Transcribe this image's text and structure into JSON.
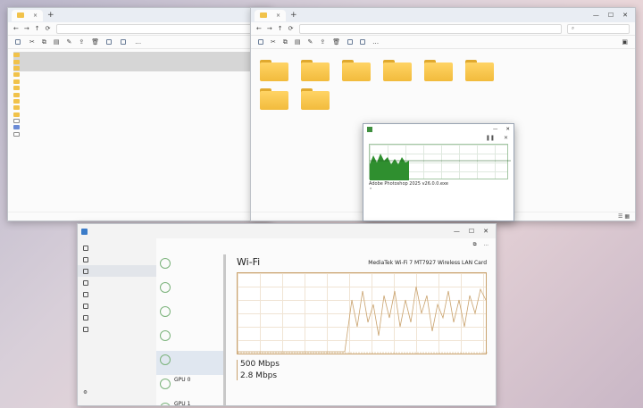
{
  "left_explorer": {
    "tab_title": "",
    "address": "",
    "search_placeholder": "",
    "commands": [
      {
        "label": "",
        "icon": "new-icon"
      },
      {
        "label": "",
        "icon": "sort-icon"
      },
      {
        "label": "",
        "icon": "view-icon"
      }
    ],
    "files": [
      {
        "name": "",
        "date": "",
        "type": "",
        "size": "",
        "kind": "folder",
        "selected": true
      },
      {
        "name": "",
        "date": "",
        "type": "",
        "size": "",
        "kind": "folder",
        "selected": true
      },
      {
        "name": "",
        "date": "",
        "type": "",
        "size": "",
        "kind": "folder",
        "selected": true
      },
      {
        "name": "",
        "date": "",
        "type": "",
        "size": "",
        "kind": "folder",
        "selected": false
      },
      {
        "name": "",
        "date": "",
        "type": "",
        "size": "",
        "kind": "folder",
        "selected": false
      },
      {
        "name": "",
        "date": "",
        "type": "",
        "size": "",
        "kind": "folder",
        "selected": false
      },
      {
        "name": "",
        "date": "",
        "type": "",
        "size": "",
        "kind": "folder",
        "selected": false
      },
      {
        "name": "",
        "date": "",
        "type": "",
        "size": "",
        "kind": "folder",
        "selected": false
      },
      {
        "name": "",
        "date": "",
        "type": "",
        "size": "",
        "kind": "folder",
        "selected": false
      },
      {
        "name": "",
        "date": "",
        "type": "",
        "size": "",
        "kind": "folder",
        "selected": false
      },
      {
        "name": "",
        "date": "",
        "type": "",
        "size": "",
        "kind": "file",
        "selected": false
      },
      {
        "name": "",
        "date": "",
        "type": "",
        "size": "",
        "kind": "exe",
        "selected": false
      },
      {
        "name": "",
        "date": "",
        "type": "",
        "size": "",
        "kind": "file",
        "selected": false
      }
    ],
    "status": ""
  },
  "right_explorer": {
    "tab_title": "",
    "address": "",
    "search_placeholder": "",
    "folders": [
      {
        "label": "",
        "style": "plain"
      },
      {
        "label": "",
        "style": "plain"
      },
      {
        "label": "",
        "style": "plain"
      },
      {
        "label": "",
        "style": "blue"
      },
      {
        "label": "",
        "style": "paper"
      },
      {
        "label": "",
        "style": "plain"
      },
      {
        "label": "",
        "style": "pic"
      },
      {
        "label": "",
        "style": "plain"
      }
    ],
    "side_text": "",
    "status": ""
  },
  "copy_dialog": {
    "title": "",
    "line1": "",
    "percent": "",
    "speed": "",
    "name_line": "Adobe Photoshop 2025 v26.0.0.exe",
    "remaining_line": "",
    "items_line": "",
    "more": ""
  },
  "task_manager": {
    "title": "",
    "header": "",
    "run_task": "",
    "nav": [
      {
        "label": "",
        "icon": "menu-icon"
      },
      {
        "label": "",
        "icon": "processes-icon"
      },
      {
        "label": "",
        "icon": "performance-icon",
        "active": true
      },
      {
        "label": "",
        "icon": "app-history-icon"
      },
      {
        "label": "",
        "icon": "startup-icon"
      },
      {
        "label": "",
        "icon": "users-icon"
      },
      {
        "label": "",
        "icon": "details-icon"
      },
      {
        "label": "",
        "icon": "services-icon"
      }
    ],
    "settings": "",
    "devices": [
      {
        "name": "",
        "sub1": "",
        "sub2": ""
      },
      {
        "name": "",
        "sub1": "",
        "sub2": ""
      },
      {
        "name": "",
        "sub1": "",
        "sub2": ""
      },
      {
        "name": "",
        "sub1": "",
        "sub2": ""
      },
      {
        "name": "",
        "sub1": "",
        "sub2": "",
        "active": true
      },
      {
        "name": "GPU 0",
        "sub1": "",
        "sub2": ""
      },
      {
        "name": "GPU 1",
        "sub1": "",
        "sub2": ""
      }
    ],
    "wifi": {
      "title": "Wi-Fi",
      "adapter": "MediaTek Wi-Fi 7 MT7927 Wireless LAN Card",
      "send_label": "",
      "send_value": "500 Mbps",
      "recv_label": "",
      "recv_value": "2.8 Mbps",
      "properties": [
        "",
        "",
        "",
        "",
        ""
      ]
    }
  },
  "watermark": {
    "logo": "",
    "site": ""
  },
  "colors": {
    "folder": "#f1c24a",
    "copy_graph": "#2f8f2f",
    "wifi_graph": "#c9a26d",
    "selection": "#d6d6d6"
  }
}
